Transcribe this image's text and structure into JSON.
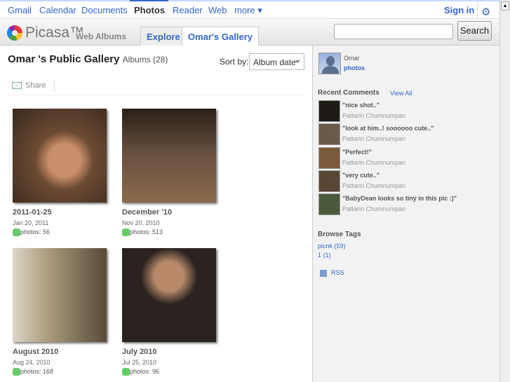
{
  "nav": {
    "links": [
      "Gmail",
      "Calendar",
      "Documents",
      "Photos",
      "Reader",
      "Web",
      "more ▾"
    ],
    "sign_in": "Sign in"
  },
  "header": {
    "brand": "Picasa™",
    "sub": "Web Albums",
    "tabs": [
      "Explore",
      "Omar's Gallery"
    ],
    "search_value": "",
    "search_button": "Search"
  },
  "main": {
    "title": "Omar 's Public Gallery",
    "albums_count": "Albums (28)",
    "sort_label": "Sort by:",
    "sort_value": "Album date",
    "share": "Share",
    "albums": [
      {
        "title": "2011-01-25",
        "date": "Jan 20, 2011",
        "photos": "photos: 56",
        "color": "#6b4a32"
      },
      {
        "title": "December '10",
        "date": "Nov 20, 2010",
        "photos": "photos: 513",
        "color": "#4b3a2a"
      },
      {
        "title": "August 2010",
        "date": "Aug 24, 2010",
        "photos": "photos: 168",
        "color": "#8a7a62"
      },
      {
        "title": "July 2010",
        "date": "Jul 25, 2010",
        "photos": "photos: 96",
        "color": "#2a2320"
      }
    ]
  },
  "sidebar": {
    "name": "Omar",
    "photos_link": "photos",
    "recent_comments": "Recent Comments",
    "view_all": "View All",
    "comments": [
      {
        "text": "\"nice shot..\"",
        "user": "Pattarin Chumnumpan",
        "color": "#1e1a16"
      },
      {
        "text": "\"look at him..! soooooo cute..\"",
        "user": "Pattarin Chumnumpan",
        "color": "#6a5a4a"
      },
      {
        "text": "\"Perfect!\"",
        "user": "Pattarin Chumnumpan",
        "color": "#7a5a3a"
      },
      {
        "text": "\"very cute..\"",
        "user": "Pattarin Chumnumpan",
        "color": "#5a4634"
      },
      {
        "text": "\"BabyDean looks so tiny in this pic :)\"",
        "user": "Pattarin Chumnumpan",
        "color": "#4a5a3a"
      }
    ],
    "browse_tags": "Browse Tags",
    "tags": [
      "picnk (59)",
      "1 (1)"
    ],
    "rss": "RSS"
  }
}
